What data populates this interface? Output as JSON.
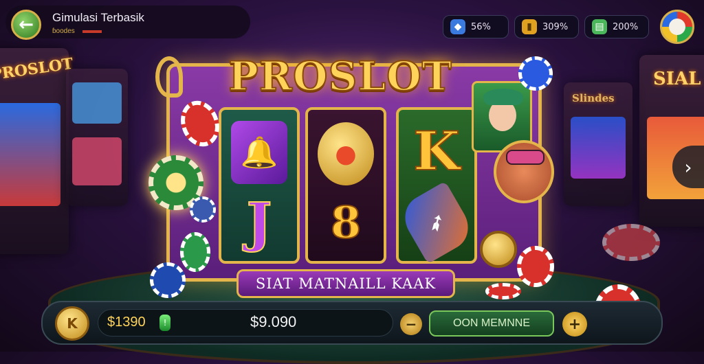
{
  "header": {
    "back_label": "←",
    "title": "Gimulasi Terbasik",
    "subtitle": "ɓoodes"
  },
  "currencies": [
    {
      "icon": "shield-gem-icon",
      "value": "56%",
      "color": "#3a7adf"
    },
    {
      "icon": "gold-card-icon",
      "value": "309%",
      "color": "#e0a020"
    },
    {
      "icon": "cash-stack-icon",
      "value": "200%",
      "color": "#4ab85a"
    }
  ],
  "machine": {
    "logo": "PROSLOT",
    "banner": "SIAT MATNAILL KAAK",
    "reels": [
      {
        "symbols": [
          "purple-bell-icon",
          "J"
        ],
        "bg": "#1f5a48"
      },
      {
        "symbols": [
          "gold-coin-icon",
          "8"
        ],
        "bg": "#3a1430"
      },
      {
        "symbols": [
          "K",
          "orange-feather-icon"
        ],
        "bg": "#2a6a2a"
      }
    ]
  },
  "bottom_bar": {
    "coin_label": "K",
    "balance": "$1390",
    "balance_gem": "!",
    "win": "$9.090",
    "minus_label": "−",
    "spin_label": "OON MEMNNE",
    "plus_label": "+"
  },
  "nav": {
    "next_label": "›"
  },
  "colors": {
    "gold": "#e3b54a",
    "purple": "#8a3aa6",
    "green": "#2a6a3a"
  },
  "background_signs": [
    "PROSLOT",
    "SIAL",
    "Slindes"
  ]
}
